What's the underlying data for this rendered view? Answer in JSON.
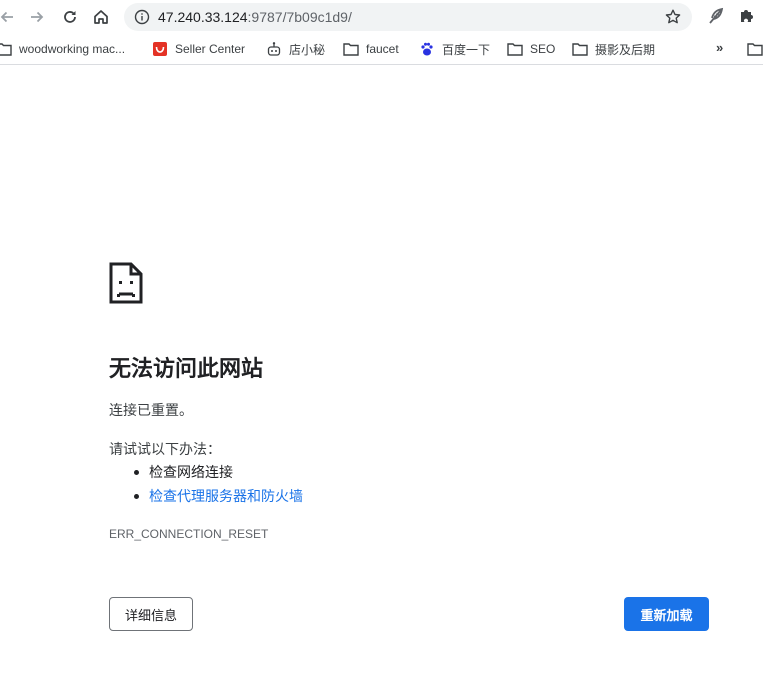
{
  "toolbar": {
    "back_icon": "back-arrow-icon",
    "forward_icon": "forward-arrow-icon",
    "reload_icon": "reload-icon",
    "home_icon": "home-icon",
    "address": {
      "host": "47.240.33.124",
      "rest": ":9787/7b09c1d9/"
    }
  },
  "bookmarks": {
    "items": [
      {
        "label": "woodworking mac...",
        "icon": "folder-icon"
      },
      {
        "label": "Seller Center",
        "icon": "seller-center-icon"
      },
      {
        "label": "店小秘",
        "icon": "robot-icon"
      },
      {
        "label": "faucet",
        "icon": "folder-icon"
      },
      {
        "label": "百度一下",
        "icon": "baidu-paw-icon"
      },
      {
        "label": "SEO",
        "icon": "folder-icon"
      },
      {
        "label": "摄影及后期",
        "icon": "folder-icon"
      }
    ],
    "more": "»"
  },
  "error": {
    "title": "无法访问此网站",
    "description": "连接已重置。",
    "suggestions_heading": "请试试以下办法：",
    "suggestions": [
      "检查网络连接",
      "检查代理服务器和防火墙"
    ],
    "code": "ERR_CONNECTION_RESET",
    "details_button": "详细信息",
    "reload_button": "重新加载"
  },
  "colors": {
    "accent": "#1a73e8",
    "text": "#202124",
    "omnibox_bg": "#f1f3f4",
    "seller_center_red": "#e43225"
  }
}
